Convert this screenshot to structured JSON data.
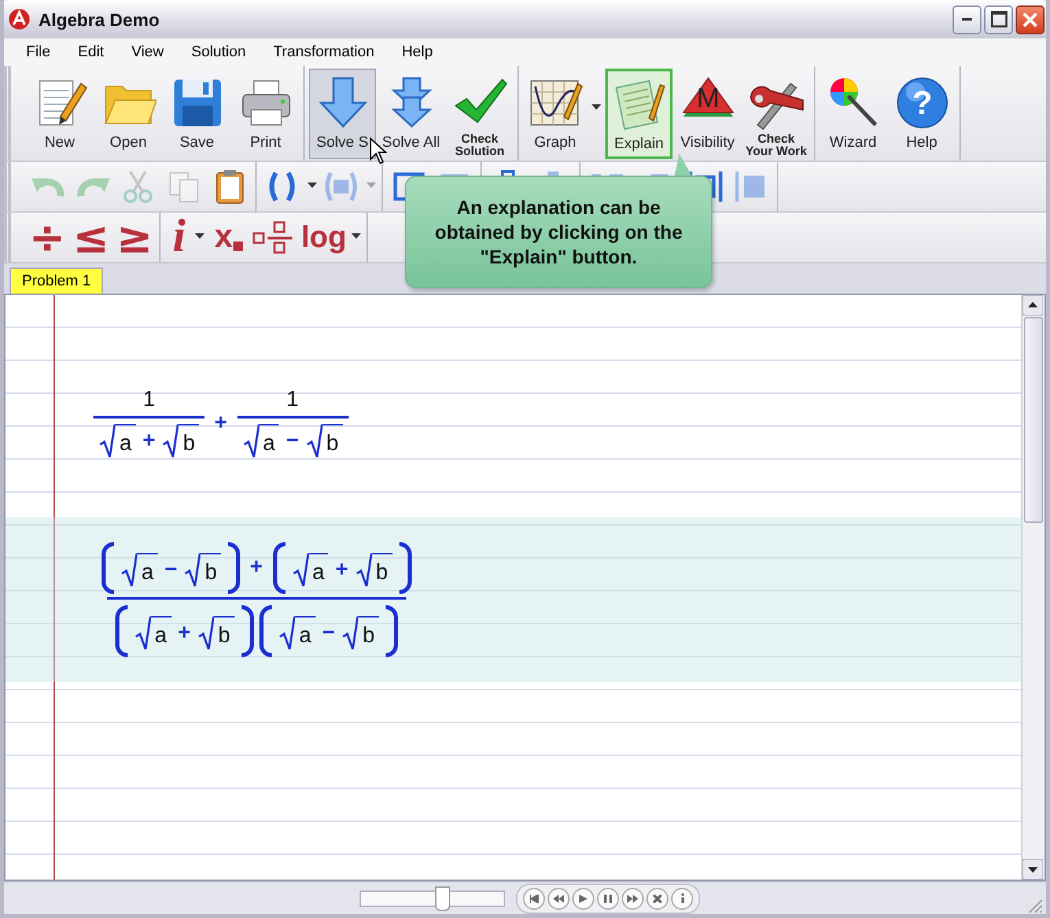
{
  "window": {
    "title": "Algebra Demo"
  },
  "menu": [
    "File",
    "Edit",
    "View",
    "Solution",
    "Transformation",
    "Help"
  ],
  "toolbar": [
    [
      {
        "label": "New",
        "pressed": false,
        "highlighted": false,
        "dropdown": false
      },
      {
        "label": "Open",
        "pressed": false,
        "highlighted": false,
        "dropdown": false
      },
      {
        "label": "Save",
        "pressed": false,
        "highlighted": false,
        "dropdown": false
      },
      {
        "label": "Print",
        "pressed": false,
        "highlighted": false,
        "dropdown": false
      }
    ],
    [
      {
        "label": "Solve S",
        "pressed": true,
        "highlighted": false,
        "dropdown": false
      },
      {
        "label": "Solve All",
        "pressed": false,
        "highlighted": false,
        "dropdown": false
      },
      {
        "label": "Check Solution",
        "pressed": false,
        "highlighted": false,
        "dropdown": false
      }
    ],
    [
      {
        "label": "Graph",
        "pressed": false,
        "highlighted": false,
        "dropdown": true
      },
      {
        "label": "Explain",
        "pressed": false,
        "highlighted": true,
        "dropdown": false
      },
      {
        "label": "Visibility",
        "icon_text": "M",
        "pressed": false,
        "highlighted": false,
        "dropdown": false
      },
      {
        "label": "Check Your Work",
        "pressed": false,
        "highlighted": false,
        "dropdown": false
      }
    ],
    [
      {
        "label": "Wizard",
        "pressed": false,
        "highlighted": false,
        "dropdown": false
      },
      {
        "label": "Help",
        "icon_text": "?",
        "pressed": false,
        "highlighted": false,
        "dropdown": false
      }
    ]
  ],
  "edit_toolbar": [
    [
      {
        "disabled": true,
        "dropdown": false
      },
      {
        "disabled": true,
        "dropdown": false
      },
      {
        "disabled": true,
        "dropdown": false
      },
      {
        "disabled": true,
        "dropdown": false
      },
      {
        "disabled": false,
        "dropdown": false
      }
    ],
    [
      {
        "disabled": false,
        "dropdown": true
      },
      {
        "disabled": true,
        "dropdown": true
      }
    ],
    [
      {
        "disabled": false,
        "dropdown": false
      },
      {
        "disabled": true,
        "dropdown": false
      }
    ],
    [
      {
        "disabled": false,
        "dropdown": false
      },
      {
        "disabled": true,
        "dropdown": false
      }
    ],
    [
      {
        "disabled": true,
        "dropdown": false
      },
      {
        "disabled": true,
        "dropdown": false
      }
    ],
    [
      {
        "disabled": false,
        "dropdown": false
      },
      {
        "disabled": true,
        "dropdown": false
      }
    ]
  ],
  "symbol_toolbar": [
    [
      {
        "kind": "symbol",
        "text": "÷",
        "dropdown": false
      },
      {
        "kind": "symbol",
        "text": "≤",
        "dropdown": false
      },
      {
        "kind": "symbol",
        "text": "≥",
        "dropdown": false
      }
    ],
    [
      {
        "kind": "italic",
        "text": "i",
        "dropdown": true
      },
      {
        "kind": "subscript",
        "text": "x",
        "dropdown": false
      },
      {
        "kind": "fraction",
        "dropdown": false
      },
      {
        "kind": "symbol",
        "text": "log",
        "dropdown": true
      }
    ]
  ],
  "tooltip": {
    "text": "An explanation can be obtained by clicking on the \"Explain\" button."
  },
  "tabs": [
    {
      "label": "Problem 1",
      "selected": true
    }
  ],
  "expressions": [
    {
      "highlighted": false,
      "formula": [
        {
          "kind": "frac",
          "num": [
            {
              "kind": "num",
              "text": "1"
            }
          ],
          "den": [
            {
              "kind": "sqrt",
              "arg": "a"
            },
            {
              "kind": "op",
              "text": "+"
            },
            {
              "kind": "sqrt",
              "arg": "b"
            }
          ]
        },
        {
          "kind": "op",
          "text": "+"
        },
        {
          "kind": "frac",
          "num": [
            {
              "kind": "num",
              "text": "1"
            }
          ],
          "den": [
            {
              "kind": "sqrt",
              "arg": "a"
            },
            {
              "kind": "op",
              "text": "−"
            },
            {
              "kind": "sqrt",
              "arg": "b"
            }
          ]
        }
      ]
    },
    {
      "highlighted": true,
      "formula": [
        {
          "kind": "frac",
          "num": [
            {
              "kind": "paren",
              "body": [
                {
                  "kind": "sqrt",
                  "arg": "a"
                },
                {
                  "kind": "op",
                  "text": "−"
                },
                {
                  "kind": "sqrt",
                  "arg": "b"
                }
              ]
            },
            {
              "kind": "op",
              "text": "+"
            },
            {
              "kind": "paren",
              "body": [
                {
                  "kind": "sqrt",
                  "arg": "a"
                },
                {
                  "kind": "op",
                  "text": "+"
                },
                {
                  "kind": "sqrt",
                  "arg": "b"
                }
              ]
            }
          ],
          "den": [
            {
              "kind": "paren",
              "body": [
                {
                  "kind": "sqrt",
                  "arg": "a"
                },
                {
                  "kind": "op",
                  "text": "+"
                },
                {
                  "kind": "sqrt",
                  "arg": "b"
                }
              ]
            },
            {
              "kind": "paren",
              "body": [
                {
                  "kind": "sqrt",
                  "arg": "a"
                },
                {
                  "kind": "op",
                  "text": "−"
                },
                {
                  "kind": "sqrt",
                  "arg": "b"
                }
              ]
            }
          ]
        }
      ]
    }
  ],
  "player": {
    "level": 0.57
  }
}
